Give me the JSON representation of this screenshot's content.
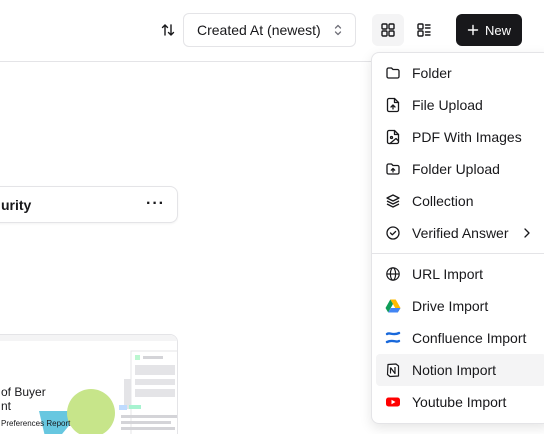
{
  "toolbar": {
    "sort_icon": "arrow-up-down-icon",
    "sort_value": "Created At (newest)",
    "grid_icon": "layout-grid-icon",
    "list_icon": "layout-list-icon",
    "new_label": "New",
    "new_icon": "plus-icon"
  },
  "card": {
    "title": "urity",
    "more_icon": "more-horizontal-icon",
    "more_label": "···"
  },
  "thumbnail": {
    "line1": "of Buyer",
    "line2": "nt",
    "line3": "Preferences Report"
  },
  "menu": {
    "items": [
      {
        "label": "Folder",
        "icon": "folder-icon"
      },
      {
        "label": "File Upload",
        "icon": "file-upload-icon"
      },
      {
        "label": "PDF With Images",
        "icon": "file-image-icon"
      },
      {
        "label": "Folder Upload",
        "icon": "folder-upload-icon"
      },
      {
        "label": "Collection",
        "icon": "layers-icon"
      },
      {
        "label": "Verified Answer",
        "icon": "circle-check-icon",
        "has_submenu": true
      }
    ],
    "import_items": [
      {
        "label": "URL Import",
        "icon": "globe-icon"
      },
      {
        "label": "Drive Import",
        "icon": "google-drive-icon"
      },
      {
        "label": "Confluence Import",
        "icon": "confluence-icon"
      },
      {
        "label": "Notion Import",
        "icon": "notion-icon",
        "highlighted": true
      },
      {
        "label": "Youtube Import",
        "icon": "youtube-icon"
      }
    ]
  },
  "colors": {
    "primary_button": "#18181b",
    "hover_bg": "#f4f4f5",
    "border": "#e4e4e7",
    "youtube_red": "#ff0000",
    "confluence_blue": "#1868db"
  }
}
